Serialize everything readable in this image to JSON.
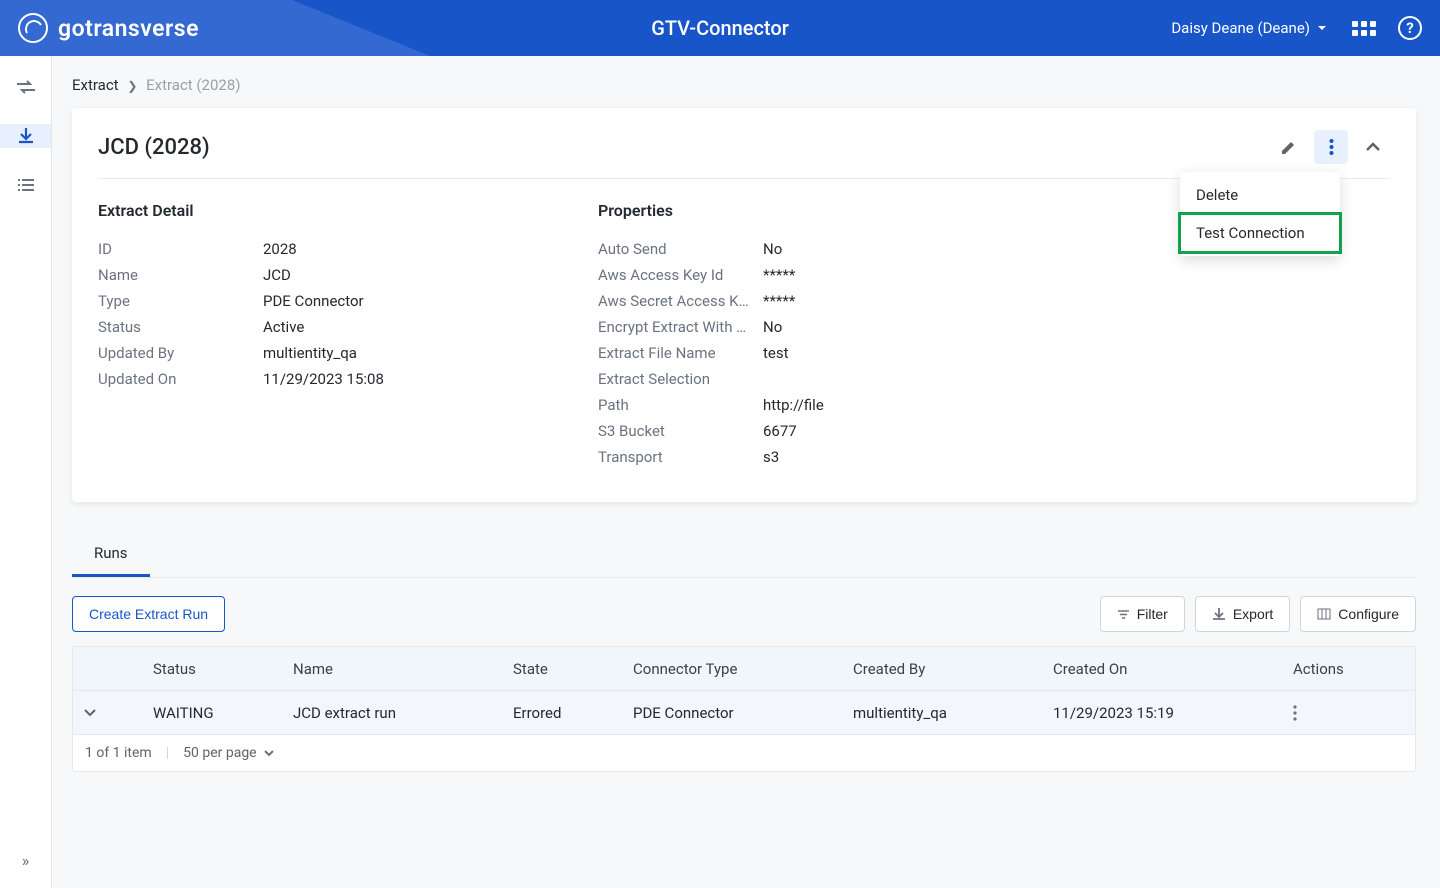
{
  "header": {
    "brand": "gotransverse",
    "app_title": "GTV-Connector",
    "user": "Daisy Deane (Deane)"
  },
  "breadcrumb": {
    "root": "Extract",
    "current": "Extract (2028)"
  },
  "card": {
    "title": "JCD (2028)"
  },
  "menu": {
    "delete": "Delete",
    "test_connection": "Test Connection"
  },
  "detail": {
    "heading": "Extract Detail",
    "rows": [
      {
        "k": "ID",
        "v": "2028"
      },
      {
        "k": "Name",
        "v": "JCD"
      },
      {
        "k": "Type",
        "v": "PDE Connector"
      },
      {
        "k": "Status",
        "v": "Active"
      },
      {
        "k": "Updated By",
        "v": "multientity_qa"
      },
      {
        "k": "Updated On",
        "v": "11/29/2023 15:08"
      }
    ]
  },
  "properties": {
    "heading": "Properties",
    "rows": [
      {
        "k": "Auto Send",
        "v": "No"
      },
      {
        "k": "Aws Access Key Id",
        "v": "*****"
      },
      {
        "k": "Aws Secret Access K…",
        "v": "*****"
      },
      {
        "k": "Encrypt Extract With …",
        "v": "No"
      },
      {
        "k": "Extract File Name",
        "v": "test"
      },
      {
        "k": "Extract Selection",
        "v": ""
      },
      {
        "k": "Path",
        "v": "http://file"
      },
      {
        "k": "S3 Bucket",
        "v": "6677"
      },
      {
        "k": "Transport",
        "v": "s3"
      }
    ]
  },
  "tabs": {
    "runs": "Runs"
  },
  "toolbar": {
    "create": "Create Extract Run",
    "filter": "Filter",
    "export": "Export",
    "configure": "Configure"
  },
  "table": {
    "headers": [
      "",
      "Status",
      "Name",
      "State",
      "Connector Type",
      "Created By",
      "Created On",
      "Actions"
    ],
    "row": {
      "status": "WAITING",
      "name": "JCD extract run",
      "state": "Errored",
      "connector_type": "PDE Connector",
      "created_by": "multientity_qa",
      "created_on": "11/29/2023 15:19"
    },
    "footer": {
      "count": "1 of 1 item",
      "per_page": "50 per page"
    }
  }
}
